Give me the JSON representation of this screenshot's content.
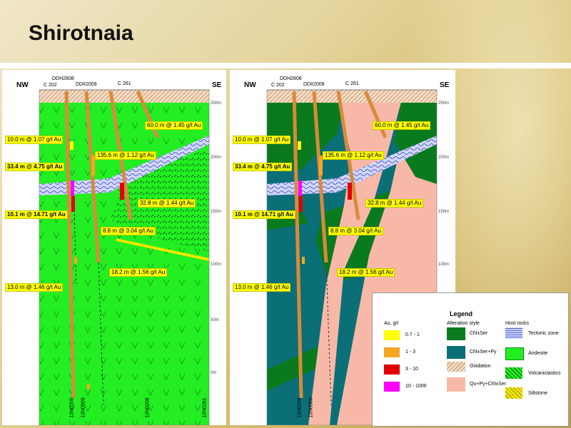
{
  "title": "Shirotnaia",
  "sections": {
    "nw": "NW",
    "se": "SE",
    "holes": [
      "C 202",
      "DDH2808",
      "DDII2009",
      "C 261"
    ],
    "elevations": [
      "250m",
      "200m",
      "150m",
      "100m",
      "50m",
      "0m"
    ],
    "collars": [
      "13N0209",
      "13N0509",
      "13N0208",
      "13N0261"
    ],
    "intercepts": [
      {
        "text": "60.0 m @ 1.45 g/t Au",
        "bold": false
      },
      {
        "text": "10.0 m @ 1.07 g/t Au",
        "bold": false
      },
      {
        "text": "135.6 m @ 1.12 g/t Au",
        "bold": false
      },
      {
        "text": "33.4 m @ 4.75 g/t Au",
        "bold": true
      },
      {
        "text": "32.8 m @ 1.44 g/t Au",
        "bold": false
      },
      {
        "text": "10.1 m  @ 14.71 g/t Au",
        "bold": true
      },
      {
        "text": "8.8 m @ 3.04 g/t Au",
        "bold": false
      },
      {
        "text": "18.2 m @ 1.56 g/t Au",
        "bold": false
      },
      {
        "text": "13.0 m @ 1.46 g/t Au",
        "bold": false
      }
    ]
  },
  "legend": {
    "title": "Legend",
    "au_heading": "Au, g/t",
    "alteration_heading": "Alteration style",
    "host_heading": "Host rocks",
    "au": [
      {
        "label": "0.7 - 1",
        "color": "#ffff00"
      },
      {
        "label": "1 - 3",
        "color": "#f5a623"
      },
      {
        "label": "3 - 10",
        "color": "#e00000"
      },
      {
        "label": "10 - 1000",
        "color": "#ff00ff"
      }
    ],
    "alteration": [
      {
        "label": "Chl±Ser",
        "color": "#0a7a1e"
      },
      {
        "label": "Chl±Ser+Py",
        "color": "#0b6f78"
      },
      {
        "label": "Oxidation",
        "color": "#f3dcc4"
      },
      {
        "label": "Qu+Py+Chl±Ser",
        "color": "#f8b8a8"
      }
    ],
    "host": [
      {
        "label": "Tectonic zone",
        "color": "#d0d6ff"
      },
      {
        "label": "Andesite",
        "color": "#22ee22"
      },
      {
        "label": "Volcaniclastics",
        "color": "#22ee22"
      },
      {
        "label": "Siltstone",
        "color": "#f2e600"
      }
    ]
  }
}
